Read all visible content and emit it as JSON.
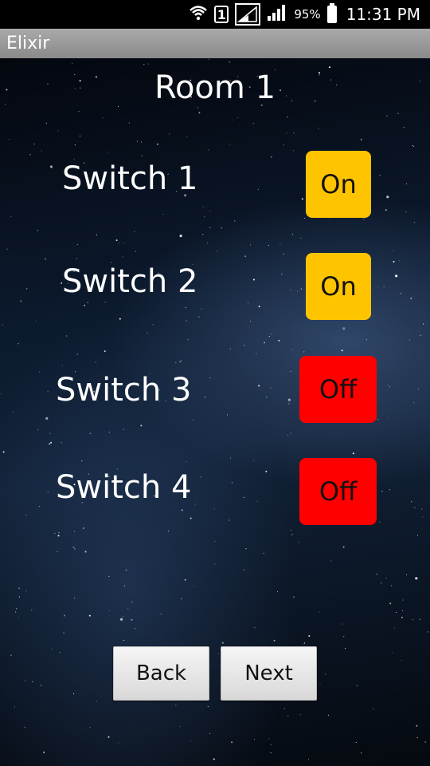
{
  "status_bar": {
    "sim_slot": "1",
    "battery_percent": "95%",
    "time": "11:31 PM",
    "icons": [
      "wifi-icon",
      "sim-icon",
      "signal-icon",
      "signal-icon",
      "battery-icon"
    ]
  },
  "app": {
    "title": "Elixir"
  },
  "room": {
    "title": "Room 1"
  },
  "switches": [
    {
      "label": "Switch 1",
      "state": "On",
      "color": "#FFC400"
    },
    {
      "label": "Switch 2",
      "state": "On",
      "color": "#FFC400"
    },
    {
      "label": "Switch 3",
      "state": "Off",
      "color": "#FF0000"
    },
    {
      "label": "Switch 4",
      "state": "Off",
      "color": "#FF0000"
    }
  ],
  "nav": {
    "back_label": "Back",
    "next_label": "Next"
  }
}
